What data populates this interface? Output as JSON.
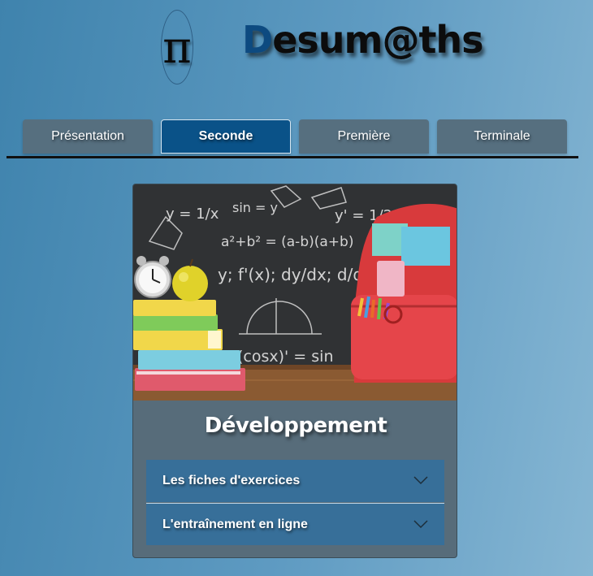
{
  "logo": {
    "symbol": "π",
    "brand_first": "D",
    "brand_rest": "esum@ths"
  },
  "nav": {
    "tabs": [
      {
        "label": "Présentation",
        "active": false
      },
      {
        "label": "Seconde",
        "active": true
      },
      {
        "label": "Première",
        "active": false
      },
      {
        "label": "Terminale",
        "active": false
      }
    ]
  },
  "card": {
    "title": "Développement",
    "image_formulas": {
      "f1": "y = 1/x",
      "f2": "sin = y",
      "f3": "y' = 1/2√x",
      "f4": "a²+b² = (a-b)(a+b)",
      "f5": "y; f'(x); dy/dx; d/dx",
      "f6": "(cosx)' = sin"
    },
    "accordions": [
      {
        "label": "Les fiches d'exercices"
      },
      {
        "label": "L'entraînement en ligne"
      }
    ]
  },
  "colors": {
    "background": "#4f8fb8",
    "tab": "#566f7f",
    "tab_active": "#0a5288",
    "card": "#576c7a",
    "accordion": "#376f99",
    "brand_accent": "#0d4a80"
  },
  "icons": {
    "logo": "pi-symbol",
    "accordion": "chevron-down-icon"
  }
}
